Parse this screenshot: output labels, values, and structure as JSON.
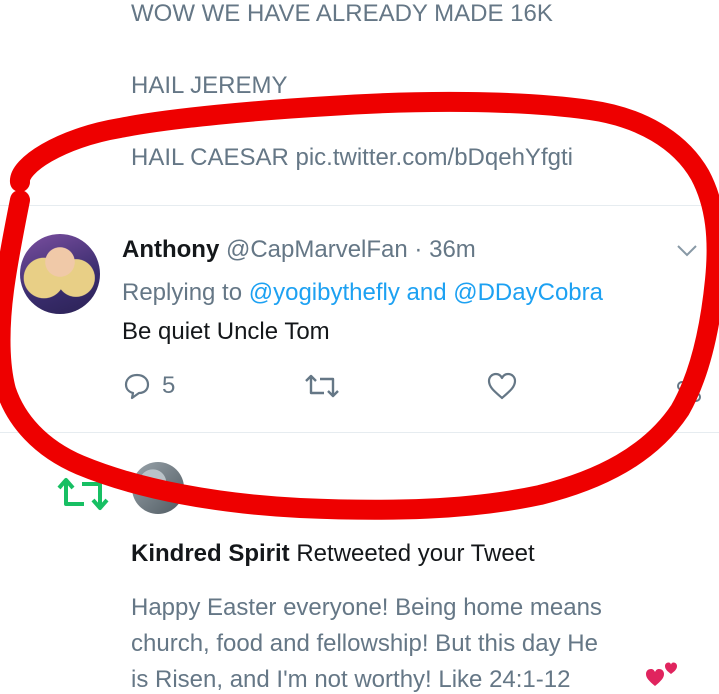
{
  "prev_tweet": {
    "line1": "WOW WE HAVE ALREADY MADE 16K",
    "line2": "HAIL JEREMY",
    "line3_text": "HAIL CAESAR ",
    "line3_link": "pic.twitter.com/bDqehYfgti"
  },
  "tweet": {
    "name": "Anthony",
    "handle": "@CapMarvelFan",
    "separator": "·",
    "time": "36m",
    "replying_label": "Replying to",
    "replying_users": "@yogibythefly and @DDayCobra",
    "text": "Be quiet Uncle Tom",
    "reply_count": "5",
    "icons": [
      "chevron-down-icon",
      "reply-icon",
      "retweet-icon",
      "like-icon",
      "share-icon"
    ]
  },
  "notification": {
    "name": "Kindred Spirit",
    "action": " Retweeted your Tweet",
    "body_line1": "Happy Easter everyone! Being home means",
    "body_line2": "church, food and fellowship! But this day He",
    "body_line3": "is Risen, and I'm not worthy! Like 24:1-12",
    "icons": [
      "retweet-notification-icon",
      "heart-emoji-icon"
    ],
    "accent_color": "#17bf63"
  },
  "colors": {
    "link": "#1da1f2",
    "secondary_text": "#657786",
    "annotation": "#ee0000"
  }
}
